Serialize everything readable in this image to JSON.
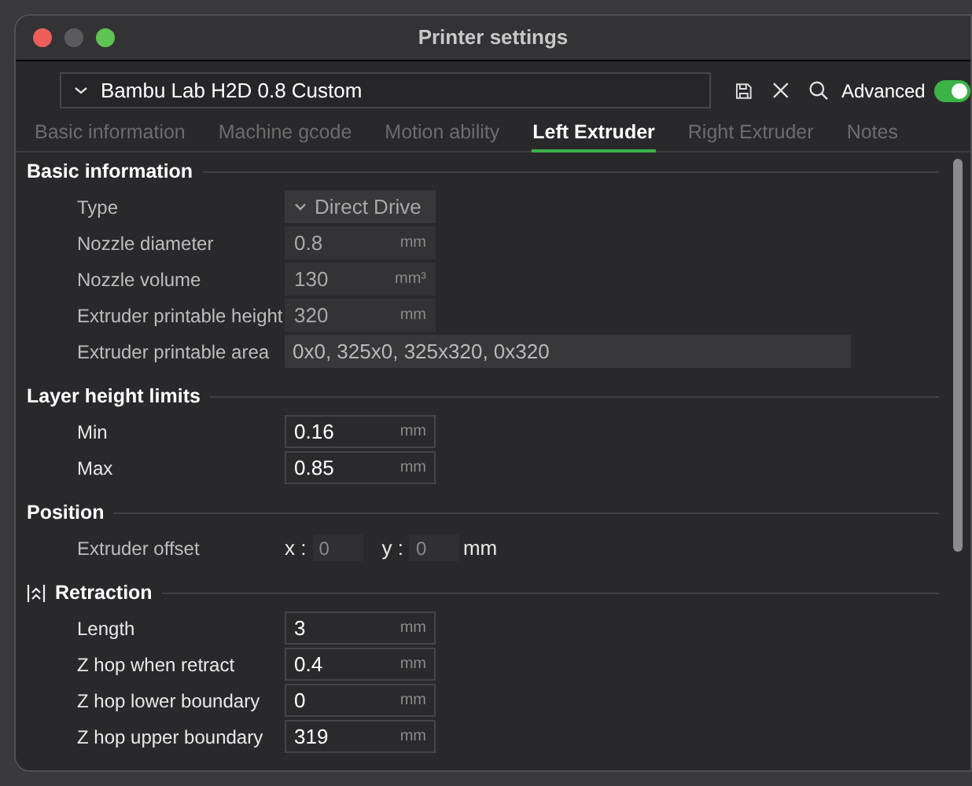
{
  "window": {
    "title": "Printer settings"
  },
  "preset": {
    "value": "Bambu Lab H2D 0.8 Custom"
  },
  "advanced": {
    "label": "Advanced",
    "on": true
  },
  "tabs": [
    {
      "label": "Basic information",
      "selected": false
    },
    {
      "label": "Machine gcode",
      "selected": false
    },
    {
      "label": "Motion ability",
      "selected": false
    },
    {
      "label": "Left Extruder",
      "selected": true
    },
    {
      "label": "Right Extruder",
      "selected": false
    },
    {
      "label": "Notes",
      "selected": false
    }
  ],
  "sections": [
    {
      "title": "Basic information",
      "icon": false,
      "rows": [
        {
          "kind": "dropdown",
          "label": "Type",
          "value": "Direct Drive",
          "disabled": true
        },
        {
          "kind": "field",
          "label": "Nozzle diameter",
          "value": "0.8",
          "unit": "mm",
          "disabled": true
        },
        {
          "kind": "field",
          "label": "Nozzle volume",
          "value": "130",
          "unit": "mm³",
          "disabled": true
        },
        {
          "kind": "field",
          "label": "Extruder printable height",
          "value": "320",
          "unit": "mm",
          "disabled": true
        },
        {
          "kind": "wide",
          "label": "Extruder printable area",
          "value": "0x0, 325x0, 325x320, 0x320",
          "disabled": true
        }
      ]
    },
    {
      "title": "Layer height limits",
      "icon": false,
      "rows": [
        {
          "kind": "field",
          "label": "Min",
          "value": "0.16",
          "unit": "mm",
          "disabled": false
        },
        {
          "kind": "field",
          "label": "Max",
          "value": "0.85",
          "unit": "mm",
          "disabled": false
        }
      ]
    },
    {
      "title": "Position",
      "icon": false,
      "rows": [
        {
          "kind": "xy",
          "label": "Extruder offset",
          "x_label": "x :",
          "x_value": "0",
          "y_label": "y :",
          "y_value": "0",
          "unit": "mm",
          "disabled": true
        }
      ]
    },
    {
      "title": "Retraction",
      "icon": true,
      "rows": [
        {
          "kind": "field",
          "label": "Length",
          "value": "3",
          "unit": "mm",
          "disabled": false
        },
        {
          "kind": "field",
          "label": "Z hop when retract",
          "value": "0.4",
          "unit": "mm",
          "disabled": false
        },
        {
          "kind": "field",
          "label": "Z hop lower boundary",
          "value": "0",
          "unit": "mm",
          "disabled": false
        },
        {
          "kind": "field",
          "label": "Z hop upper boundary",
          "value": "319",
          "unit": "mm",
          "disabled": false
        }
      ]
    }
  ]
}
